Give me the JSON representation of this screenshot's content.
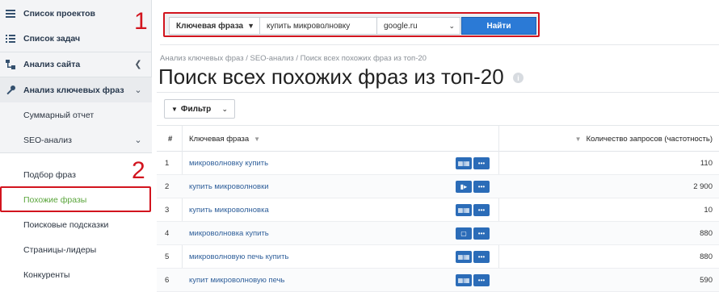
{
  "sidebar": {
    "items": [
      {
        "label": "Список проектов"
      },
      {
        "label": "Список задач"
      },
      {
        "label": "Анализ сайта"
      },
      {
        "label": "Анализ ключевых фраз"
      },
      {
        "label": "Суммарный отчет"
      },
      {
        "label": "SEO-анализ"
      },
      {
        "label": "Подбор фраз"
      },
      {
        "label": "Похожие фразы"
      },
      {
        "label": "Поисковые подсказки"
      },
      {
        "label": "Страницы-лидеры"
      },
      {
        "label": "Конкуренты"
      }
    ]
  },
  "annotations": {
    "one": "1",
    "two": "2",
    "color": "#d2141e"
  },
  "search": {
    "mode_select": "Ключевая фраза",
    "query": "купить микроволновку",
    "engine_select": "google.ru",
    "find_label": "Найти"
  },
  "breadcrumb": "Анализ ключевых фраз / SEO-анализ / Поиск всех похожих фраз из топ-20",
  "title": "Поиск всех похожих фраз из топ-20",
  "filter": {
    "label": "Фильтр"
  },
  "table": {
    "headers": {
      "num": "#",
      "phrase": "Ключевая фраза",
      "freq": "Количество запросов (частотность)"
    },
    "rows": [
      {
        "num": "1",
        "phrase": "микроволновку купить",
        "freq": "110"
      },
      {
        "num": "2",
        "phrase": "купить микроволновки",
        "freq": "2 900"
      },
      {
        "num": "3",
        "phrase": "купить микроволновка",
        "freq": "10"
      },
      {
        "num": "4",
        "phrase": "микроволновка купить",
        "freq": "880"
      },
      {
        "num": "5",
        "phrase": "микроволновую печь купить",
        "freq": "880"
      },
      {
        "num": "6",
        "phrase": "купит микроволновую печь",
        "freq": "590"
      }
    ]
  },
  "colors": {
    "accent": "#2b7ad6",
    "link": "#2f5f9a",
    "active": "#5aa53b"
  }
}
